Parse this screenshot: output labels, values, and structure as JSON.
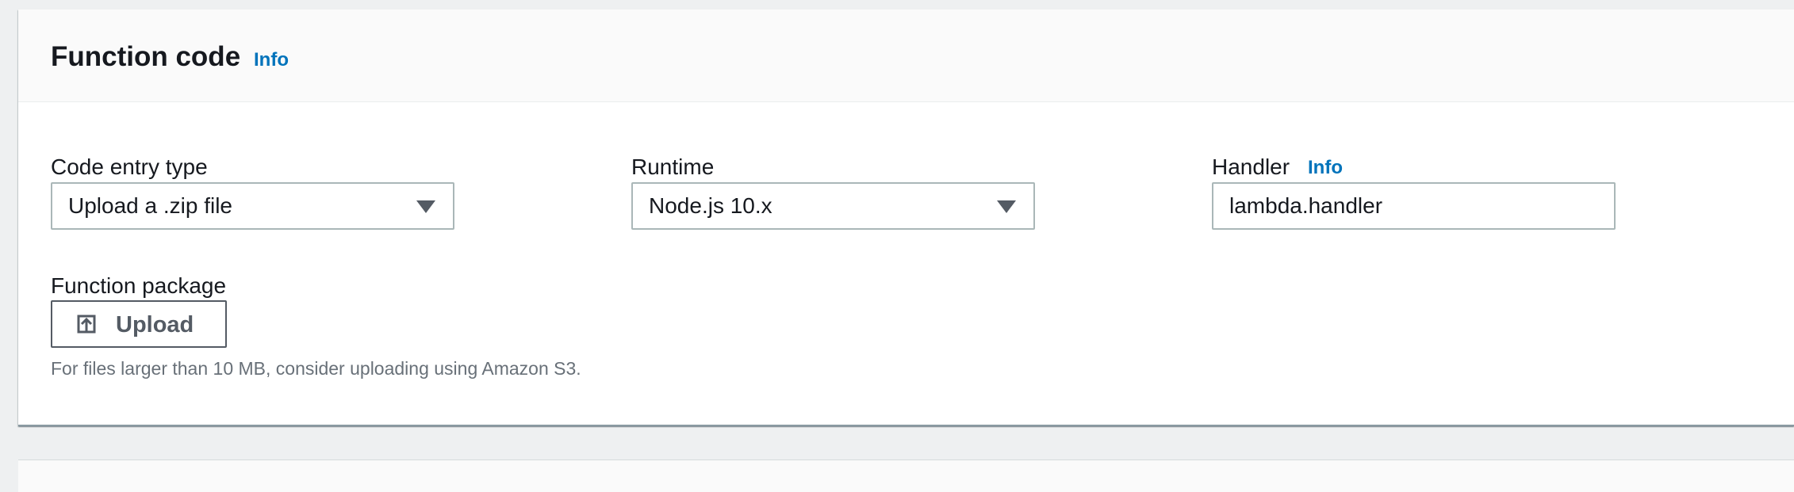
{
  "panel": {
    "title": "Function code",
    "title_info": "Info"
  },
  "fields": {
    "code_entry_type": {
      "label": "Code entry type",
      "selected": "Upload a .zip file"
    },
    "runtime": {
      "label": "Runtime",
      "selected": "Node.js 10.x"
    },
    "handler": {
      "label": "Handler",
      "info": "Info",
      "value": "lambda.handler"
    },
    "function_package": {
      "label": "Function package",
      "upload_label": "Upload",
      "hint": "For files larger than 10 MB, consider uploading using Amazon S3."
    }
  },
  "icons": {
    "upload": "upload-icon",
    "dropdown": "caret-down-icon"
  },
  "colors": {
    "link": "#0073bb",
    "text": "#16191f",
    "secondary_text": "#687078",
    "border": "#aab7b8",
    "background": "#eef0f1"
  }
}
